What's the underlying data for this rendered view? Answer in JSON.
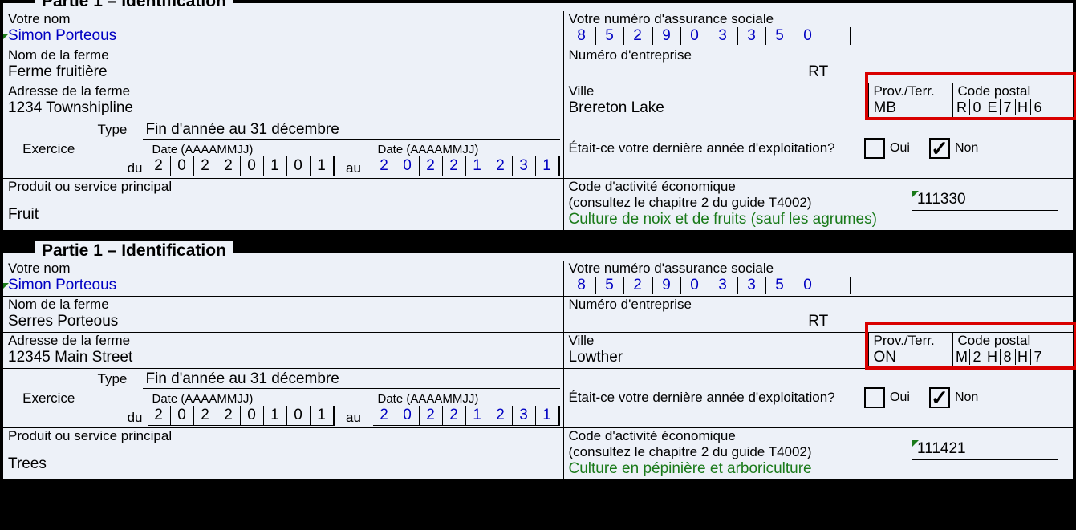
{
  "legend": "Partie 1 – Identification",
  "labels": {
    "nom": "Votre nom",
    "nas": "Votre numéro d'assurance sociale",
    "ferme": "Nom de la ferme",
    "bn": "Numéro d'entreprise",
    "adresse": "Adresse de la ferme",
    "ville": "Ville",
    "prov": "Prov./Terr.",
    "postal": "Code postal",
    "exercice": "Exercice",
    "type": "Type",
    "dateFmt": "Date (AAAAMMJJ)",
    "du": "du",
    "au": "au",
    "prod": "Produit ou service principal",
    "codeActivite": "Code d'activité économique",
    "guide": "(consultez le chapitre 2 du guide T4002)",
    "lastYear": "Était-ce votre dernière année d'exploitation?",
    "oui": "Oui",
    "non": "Non",
    "rt": "RT"
  },
  "forms": [
    {
      "name": "Simon Porteous",
      "sin": [
        "8",
        "5",
        "2",
        "9",
        "0",
        "3",
        "3",
        "5",
        "0"
      ],
      "farmName": "Ferme fruitière",
      "farmAddress": "1234 Townshipline",
      "city": "Brereton Lake",
      "prov": "MB",
      "postal": [
        "R",
        "0",
        "E",
        "7",
        "H",
        "6"
      ],
      "fiscalType": "Fin d'année au 31 décembre",
      "dateFrom": [
        "2",
        "0",
        "2",
        "2",
        "0",
        "1",
        "0",
        "1"
      ],
      "dateTo": [
        "2",
        "0",
        "2",
        "2",
        "1",
        "2",
        "3",
        "1"
      ],
      "lastYear": "Non",
      "product": "Fruit",
      "activityCode": "111330",
      "activityDesc": "Culture de noix et de fruits (sauf les agrumes)"
    },
    {
      "name": "Simon Porteous",
      "sin": [
        "8",
        "5",
        "2",
        "9",
        "0",
        "3",
        "3",
        "5",
        "0"
      ],
      "farmName": "Serres Porteous",
      "farmAddress": "12345 Main Street",
      "city": "Lowther",
      "prov": "ON",
      "postal": [
        "M",
        "2",
        "H",
        "8",
        "H",
        "7"
      ],
      "fiscalType": "Fin d'année au 31 décembre",
      "dateFrom": [
        "2",
        "0",
        "2",
        "2",
        "0",
        "1",
        "0",
        "1"
      ],
      "dateTo": [
        "2",
        "0",
        "2",
        "2",
        "1",
        "2",
        "3",
        "1"
      ],
      "lastYear": "Non",
      "product": "Trees",
      "activityCode": "111421",
      "activityDesc": "Culture en pépinière et arboriculture"
    }
  ]
}
